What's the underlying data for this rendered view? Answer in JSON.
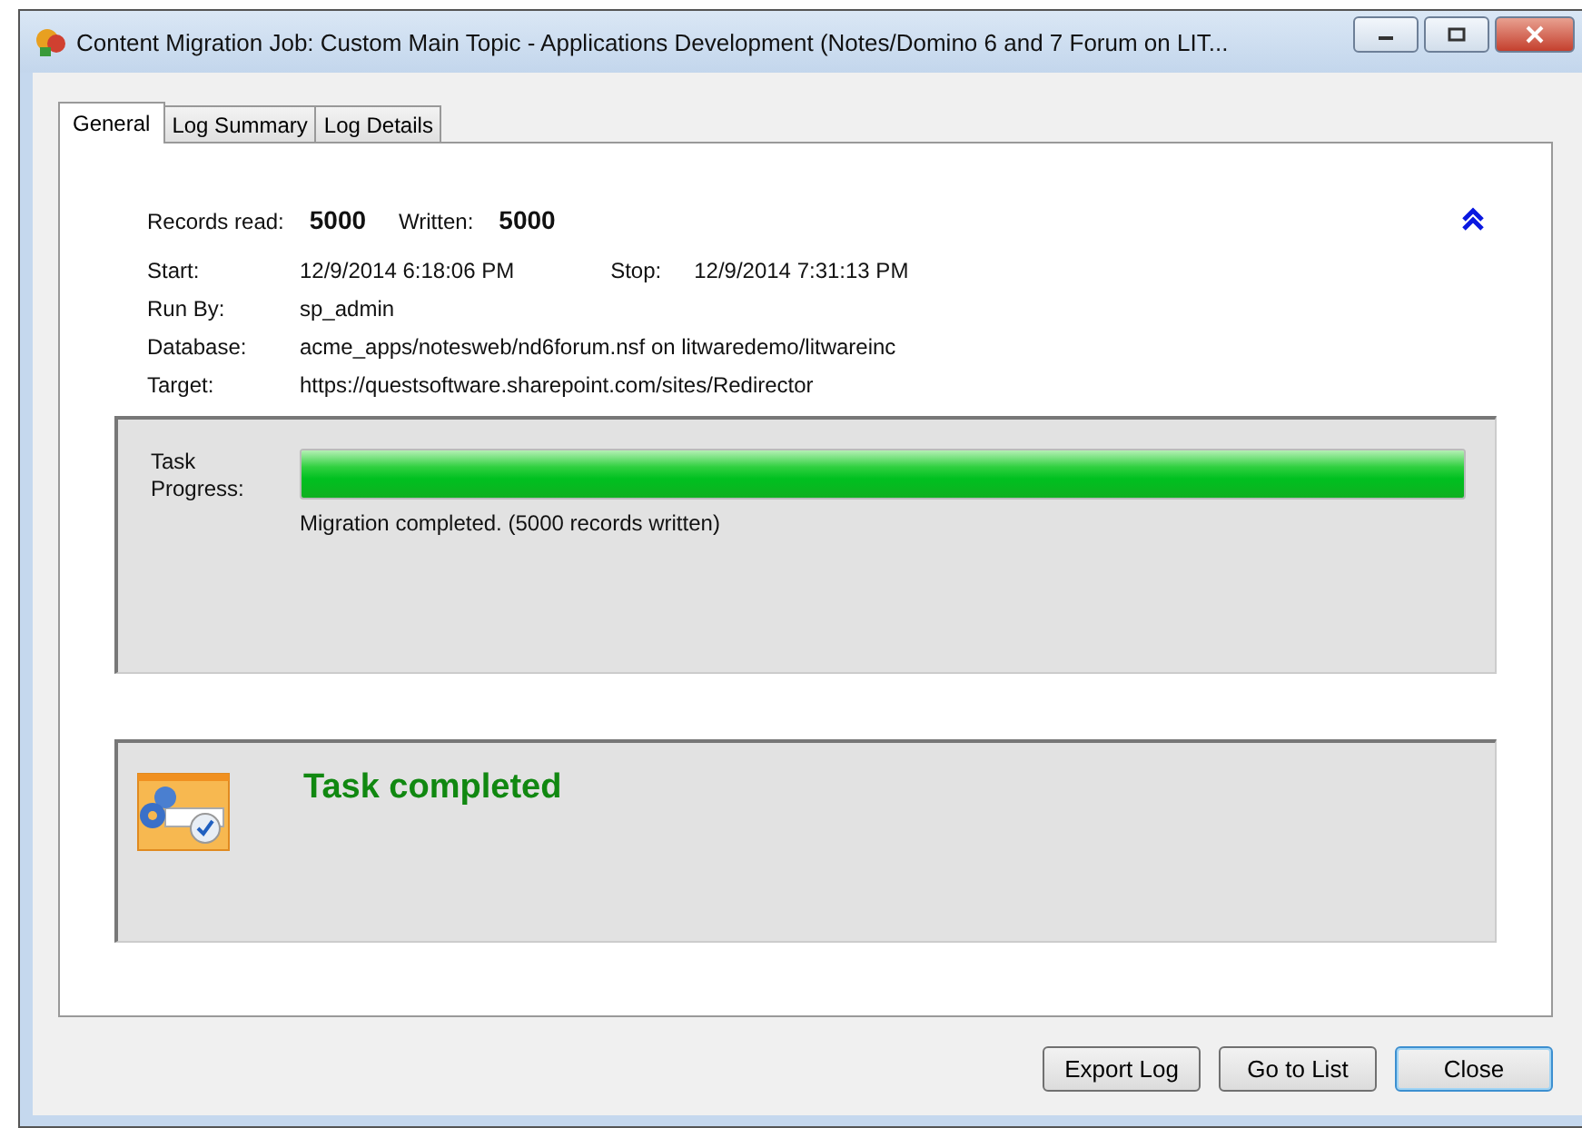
{
  "window": {
    "title": "Content Migration Job: Custom Main Topic - Applications Development (Notes/Domino 6 and 7 Forum on LIT..."
  },
  "tabs": [
    {
      "label": "General",
      "selected": true
    },
    {
      "label": "Log Summary",
      "selected": false
    },
    {
      "label": "Log Details",
      "selected": false
    }
  ],
  "summary": {
    "records_read_label": "Records read:",
    "records_read": "5000",
    "written_label": "Written:",
    "written": "5000"
  },
  "details": [
    {
      "label": "Start:",
      "value": "12/9/2014 6:18:06 PM",
      "extra_label": "Stop:",
      "extra_value": "12/9/2014 7:31:13 PM"
    },
    {
      "label": "Run By:",
      "value": "sp_admin"
    },
    {
      "label": "Database:",
      "value": "acme_apps/notesweb/nd6forum.nsf on litwaredemo/litwareinc"
    },
    {
      "label": "Target:",
      "value": "https://questsoftware.sharepoint.com/sites/Redirector"
    }
  ],
  "progress": {
    "label": "Task\nProgress:",
    "level": 1,
    "message": "Migration completed. (5000 records written)"
  },
  "status": {
    "message": "Task completed"
  },
  "buttons": [
    "Export Log",
    "Go to List",
    "Close"
  ]
}
